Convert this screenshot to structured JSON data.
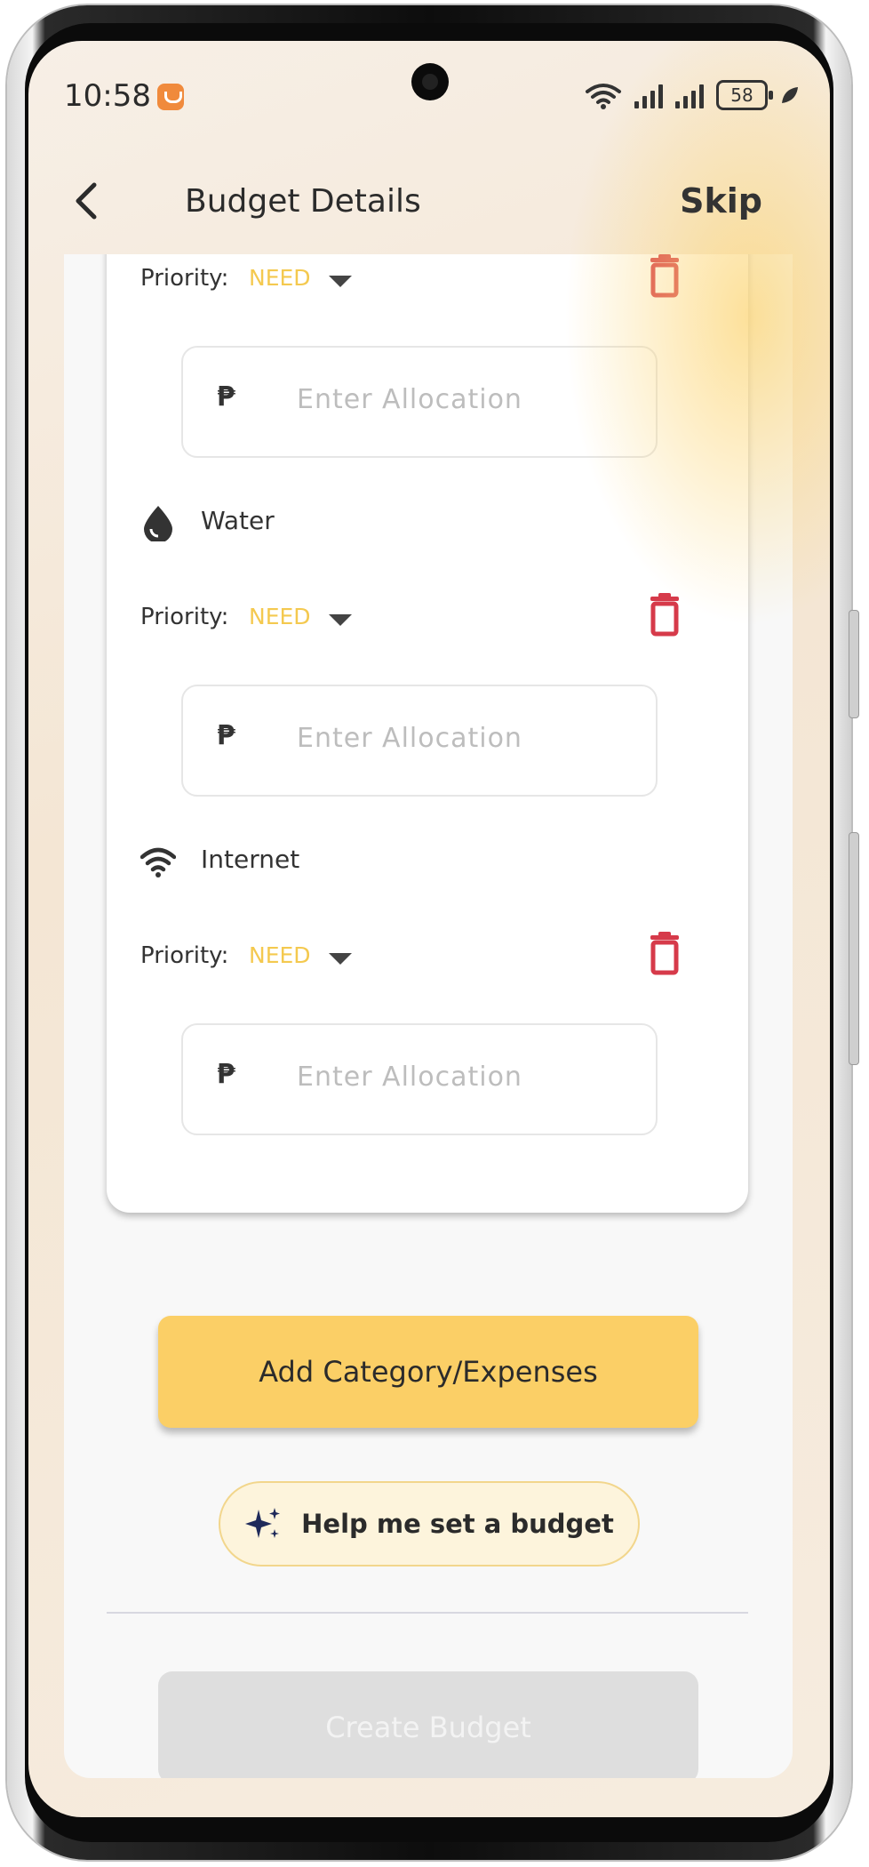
{
  "status_bar": {
    "time": "10:58",
    "battery": "58"
  },
  "header": {
    "title": "Budget Details",
    "skip_label": "Skip"
  },
  "categories": [
    {
      "name": "",
      "icon": "none",
      "priority_label": "Priority:",
      "priority_value": "NEED",
      "currency": "₱",
      "allocation_placeholder": "Enter Allocation",
      "allocation_value": ""
    },
    {
      "name": "Water",
      "icon": "water-drop-icon",
      "priority_label": "Priority:",
      "priority_value": "NEED",
      "currency": "₱",
      "allocation_placeholder": "Enter Allocation",
      "allocation_value": ""
    },
    {
      "name": "Internet",
      "icon": "wifi-icon",
      "priority_label": "Priority:",
      "priority_value": "NEED",
      "currency": "₱",
      "allocation_placeholder": "Enter Allocation",
      "allocation_value": ""
    }
  ],
  "actions": {
    "add_category_label": "Add Category/Expenses",
    "help_label": "Help me set a budget",
    "create_label": "Create Budget"
  },
  "colors": {
    "accent": "#fbcf66",
    "priority": "#f4c94f",
    "delete": "#d63a4a",
    "disabled": "#dedede"
  }
}
